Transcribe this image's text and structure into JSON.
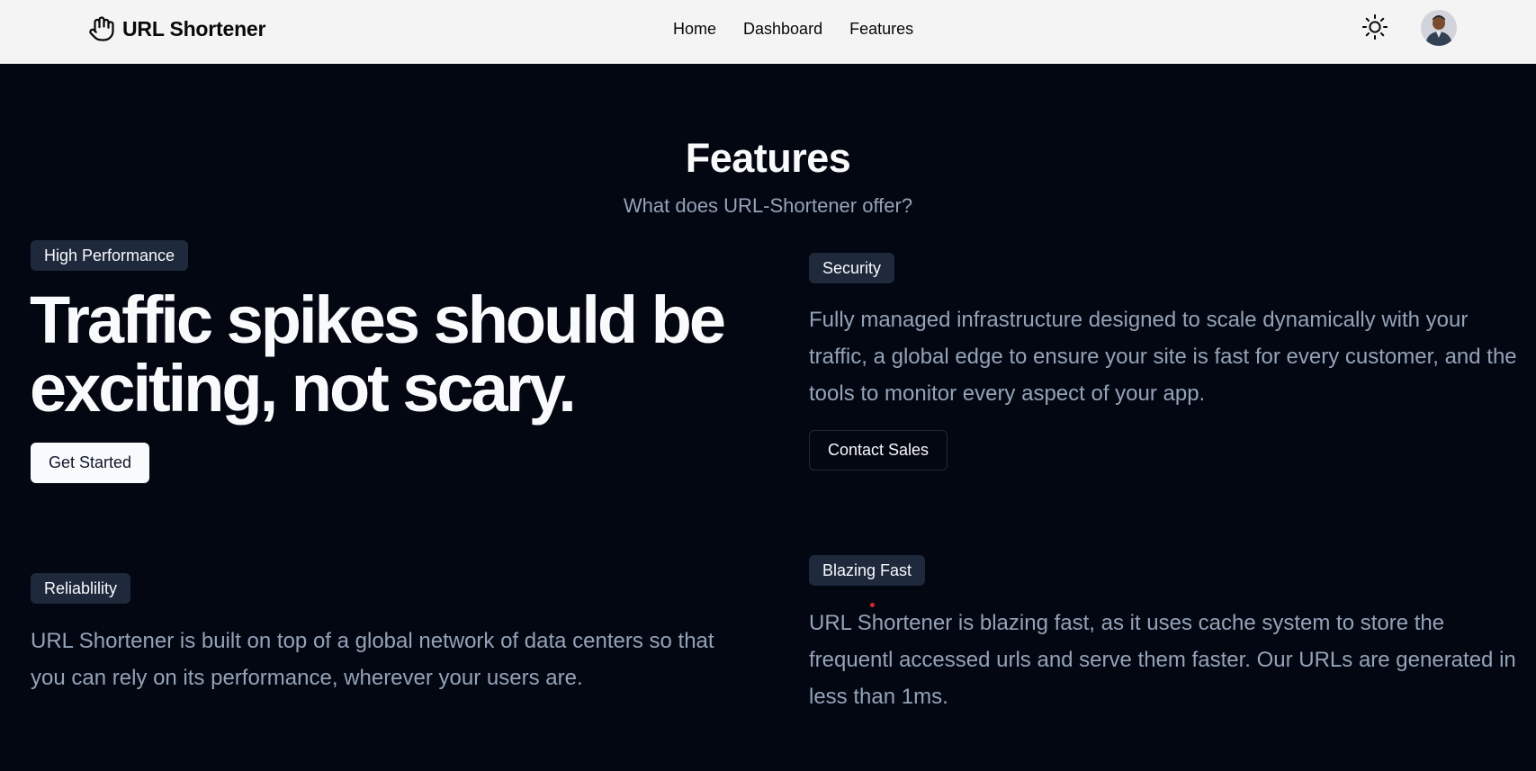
{
  "navbar": {
    "brand": {
      "icon": "hand-pointer-icon",
      "name": "URL Shortener"
    },
    "links": [
      "Home",
      "Dashboard",
      "Features"
    ],
    "theme_toggle_icon": "sun-icon",
    "avatar": "user-avatar"
  },
  "features_section": {
    "title": "Features",
    "subtitle": "What does URL-Shortener offer?",
    "high_performance": {
      "badge": "High Performance",
      "headline_line1": "Traffic spikes should be",
      "headline_line2": "exciting, not scary.",
      "button": "Get Started"
    },
    "security": {
      "badge": "Security",
      "description": "Fully managed infrastructure designed to scale dynamically with your traffic, a global edge to ensure your site is fast for every customer, and the tools to monitor every aspect of your app.",
      "button": "Contact Sales"
    },
    "reliability": {
      "badge": "Reliablility",
      "description": "URL Shortener is built on top of a global network of data centers so that you can rely on its performance, wherever your users are."
    },
    "blazing_fast": {
      "badge": "Blazing Fast",
      "description": "URL Shortener is blazing fast, as it uses cache system to store the frequentl accessed urls and serve them faster. Our URLs are generated in less than 1ms."
    }
  },
  "colors": {
    "background": "#030711",
    "navbar_bg": "#f4f4f5",
    "badge_bg": "#1e293b",
    "muted_text": "#94a3b8",
    "cursor_dot": "#dc2626"
  }
}
